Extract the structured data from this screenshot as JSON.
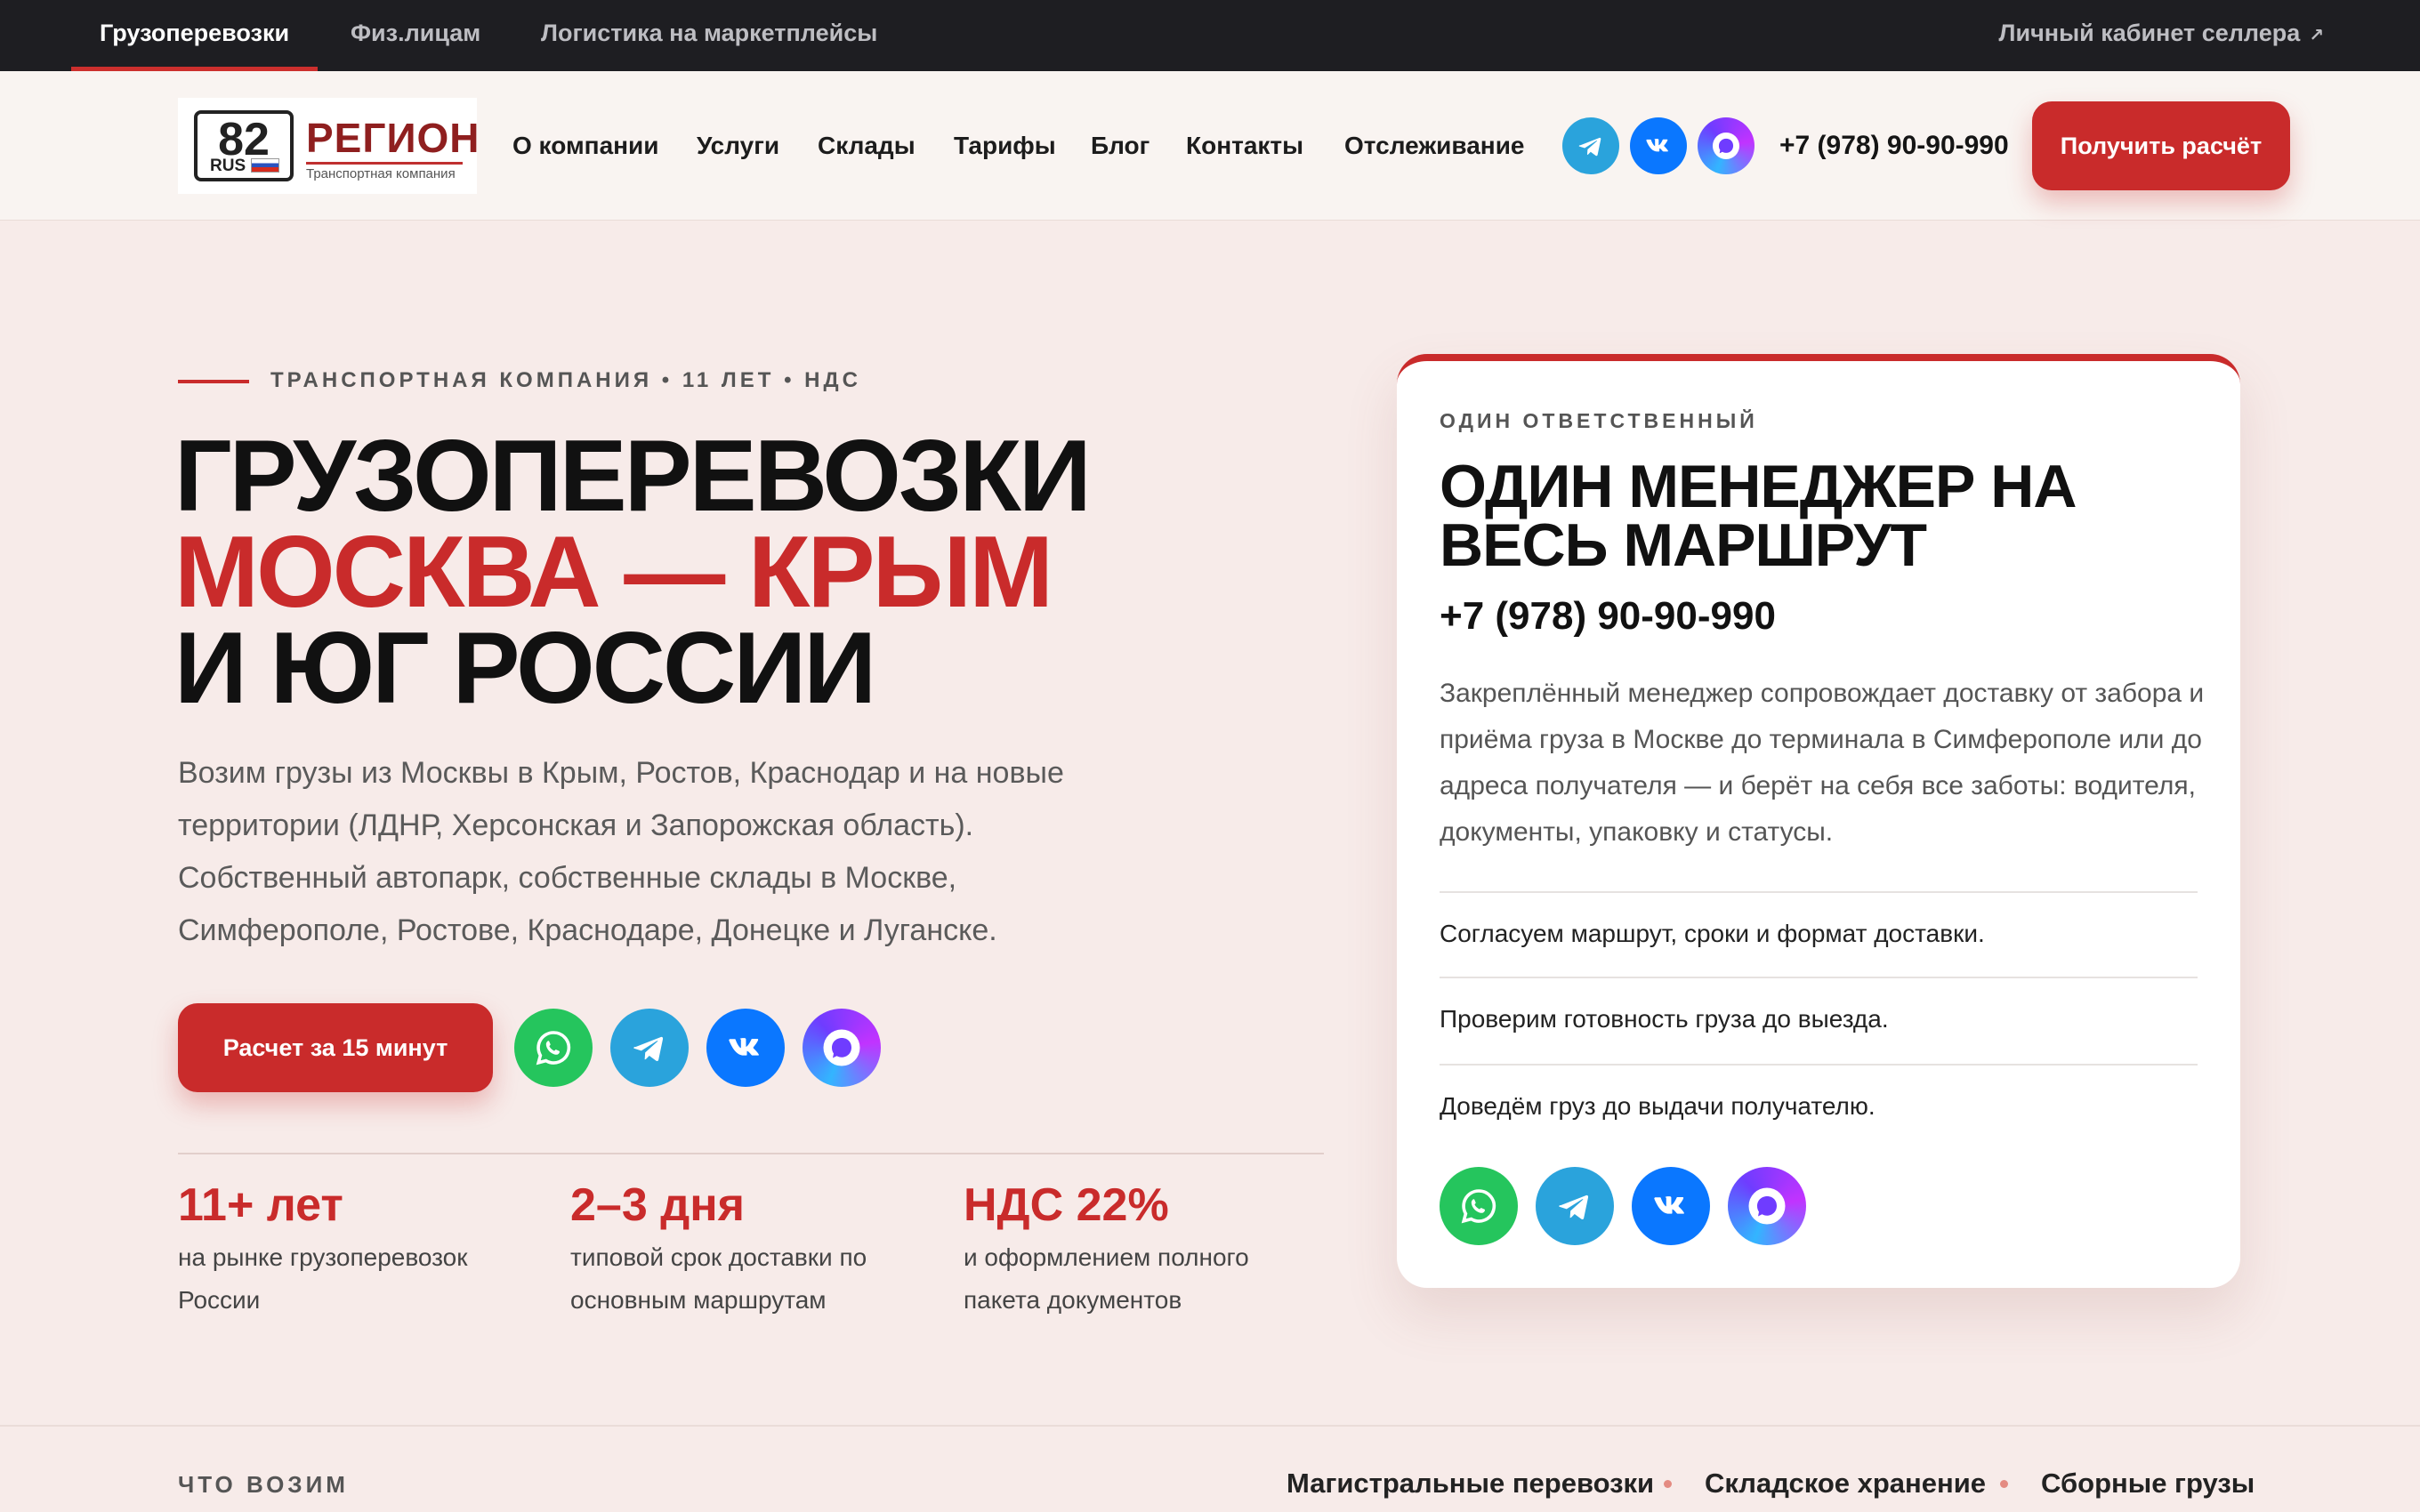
{
  "topbar": {
    "tabs": [
      "Грузоперевозки",
      "Физ.лицам",
      "Логистика на маркетплейсы"
    ],
    "active_tab": "Грузоперевозки",
    "seller_link": "Личный кабинет селлера",
    "seller_arrow": "↗"
  },
  "header": {
    "logo": {
      "plate_number": "82",
      "plate_region": "RUS",
      "word": "РЕГИОН",
      "tagline": "Транспортная компания"
    },
    "nav": [
      "О компании",
      "Услуги",
      "Склады",
      "Тарифы",
      "Блог",
      "Контакты",
      "Отслеживание"
    ],
    "messenger_icons": [
      "telegram-icon",
      "vk-icon",
      "max-icon"
    ],
    "phone": "+7 (978) 90-90-990",
    "cta": "Получить расчёт"
  },
  "hero": {
    "eyebrow": "ТРАНСПОРТНАЯ КОМПАНИЯ • 11 ЛЕТ • НДС",
    "title_line1": "ГРУЗОПЕРЕВОЗКИ",
    "title_line2": "МОСКВА — КРЫМ",
    "title_line3": "И ЮГ РОССИИ",
    "lead": "Возим грузы из Москвы в Крым, Ростов, Краснодар и на новые территории (ЛДНР, Херсонская и Запорожская область). Собственный автопарк, собственные склады в Москве, Симферополе, Ростове, Краснодаре, Донецке и Луганске.",
    "cta": "Расчет за 15 минут",
    "messenger_icons": [
      "whatsapp-icon",
      "telegram-icon",
      "vk-icon",
      "max-icon"
    ],
    "stats": [
      {
        "value": "11+ лет",
        "desc": "на рынке грузоперевозок России"
      },
      {
        "value": "2–3 дня",
        "desc": "типовой срок доставки по основным маршрутам"
      },
      {
        "value": "НДС 22%",
        "desc": "и оформлением полного пакета документов"
      }
    ]
  },
  "card": {
    "kicker": "ОДИН ОТВЕТСТВЕННЫЙ",
    "title": "ОДИН МЕНЕДЖЕР НА ВЕСЬ МАРШРУТ",
    "phone": "+7 (978) 90-90-990",
    "text": "Закреплённый менеджер сопровождает доставку от забора и приёма груза в Москве до терминала в Симферополе или до адреса получателя — и берёт на себя все заботы: водителя, документы, упаковку и статусы.",
    "points": [
      "Согласуем маршрут, сроки и формат доставки.",
      "Проверим готовность груза до выезда.",
      "Доведём груз до выдачи получателю."
    ],
    "messenger_icons": [
      "whatsapp-icon",
      "telegram-icon",
      "vk-icon",
      "max-icon"
    ]
  },
  "bottom": {
    "label": "ЧТО ВОЗИМ",
    "services": [
      "Магистральные перевозки",
      "Складское хранение",
      "Сборные грузы"
    ]
  },
  "colors": {
    "accent": "#c92b2b",
    "dark": "#1e1e22",
    "background": "#f7ebe9"
  }
}
